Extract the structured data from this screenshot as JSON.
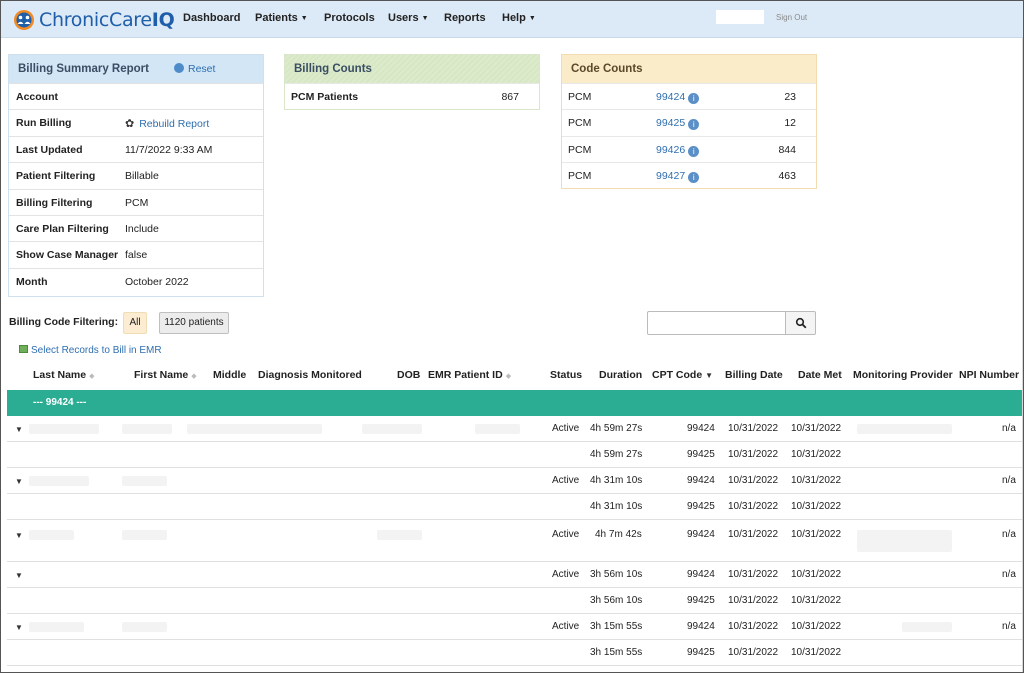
{
  "nav": {
    "logo_prefix": "ChronicCare",
    "logo_suffix": "IQ",
    "items": [
      {
        "label": "Dashboard",
        "dropdown": false
      },
      {
        "label": "Patients",
        "dropdown": true
      },
      {
        "label": "Protocols",
        "dropdown": false
      },
      {
        "label": "Users",
        "dropdown": true
      },
      {
        "label": "Reports",
        "dropdown": false
      },
      {
        "label": "Help",
        "dropdown": true
      }
    ],
    "sign_out": "Sign Out"
  },
  "summary": {
    "title": "Billing Summary Report",
    "reset_label": "Reset",
    "rows": [
      {
        "key": "Account",
        "value": ""
      },
      {
        "key": "Run Billing",
        "value": "Rebuild Report"
      },
      {
        "key": "Last Updated",
        "value": "11/7/2022 9:33 AM"
      },
      {
        "key": "Patient Filtering",
        "value": "Billable"
      },
      {
        "key": "Billing Filtering",
        "value": "PCM"
      },
      {
        "key": "Care Plan Filtering",
        "value": "Include"
      },
      {
        "key": "Show Case Manager",
        "value": "false"
      },
      {
        "key": "Month",
        "value": "October 2022"
      }
    ]
  },
  "billing_counts": {
    "title": "Billing Counts",
    "rows": [
      {
        "label": "PCM Patients",
        "value": "867"
      }
    ]
  },
  "code_counts": {
    "title": "Code Counts",
    "rows": [
      {
        "type": "PCM",
        "code": "99424",
        "count": "23"
      },
      {
        "type": "PCM",
        "code": "99425",
        "count": "12"
      },
      {
        "type": "PCM",
        "code": "99426",
        "count": "844"
      },
      {
        "type": "PCM",
        "code": "99427",
        "count": "463"
      }
    ]
  },
  "filter": {
    "label": "Billing Code Filtering:",
    "all_label": "All",
    "patients_label": "1120 patients",
    "select_emr": "Select Records to Bill in EMR",
    "search_placeholder": ""
  },
  "table": {
    "headers": {
      "last_name": "Last Name",
      "first_name": "First Name",
      "middle": "Middle",
      "diagnosis": "Diagnosis Monitored",
      "dob": "DOB",
      "emr_id": "EMR Patient ID",
      "status": "Status",
      "duration": "Duration",
      "cpt": "CPT Code",
      "billing_date": "Billing Date",
      "date_met": "Date Met",
      "provider": "Monitoring Provider",
      "npi": "NPI Number"
    },
    "group_label": "--- 99424 ---",
    "rows": [
      {
        "expand": true,
        "status": "Active",
        "duration": "4h 59m 27s",
        "cpt": "99424",
        "billing_date": "10/31/2022",
        "date_met": "10/31/2022",
        "npi": "n/a"
      },
      {
        "expand": false,
        "status": "",
        "duration": "4h 59m 27s",
        "cpt": "99425",
        "billing_date": "10/31/2022",
        "date_met": "10/31/2022",
        "npi": ""
      },
      {
        "expand": true,
        "status": "Active",
        "duration": "4h 31m 10s",
        "cpt": "99424",
        "billing_date": "10/31/2022",
        "date_met": "10/31/2022",
        "npi": "n/a"
      },
      {
        "expand": false,
        "status": "",
        "duration": "4h 31m 10s",
        "cpt": "99425",
        "billing_date": "10/31/2022",
        "date_met": "10/31/2022",
        "npi": ""
      },
      {
        "expand": true,
        "status": "Active",
        "duration": "4h 7m 42s",
        "cpt": "99424",
        "billing_date": "10/31/2022",
        "date_met": "10/31/2022",
        "npi": "n/a"
      },
      {
        "expand": true,
        "status": "Active",
        "duration": "3h 56m 10s",
        "cpt": "99424",
        "billing_date": "10/31/2022",
        "date_met": "10/31/2022",
        "npi": "n/a"
      },
      {
        "expand": false,
        "status": "",
        "duration": "3h 56m 10s",
        "cpt": "99425",
        "billing_date": "10/31/2022",
        "date_met": "10/31/2022",
        "npi": ""
      },
      {
        "expand": true,
        "status": "Active",
        "duration": "3h 15m 55s",
        "cpt": "99424",
        "billing_date": "10/31/2022",
        "date_met": "10/31/2022",
        "npi": "n/a"
      },
      {
        "expand": false,
        "status": "",
        "duration": "3h 15m 55s",
        "cpt": "99425",
        "billing_date": "10/31/2022",
        "date_met": "10/31/2022",
        "npi": ""
      }
    ]
  },
  "colors": {
    "nav_bg": "#dce9f6",
    "brand": "#1f5ea8",
    "group_row": "#2bad94",
    "link": "#2f6fb0"
  }
}
